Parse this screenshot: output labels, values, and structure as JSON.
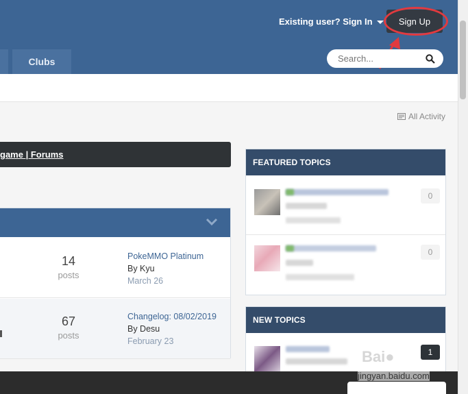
{
  "header": {
    "signin_label": "Existing user? Sign In",
    "signup_label": "Sign Up",
    "tabs": [
      {
        "label": "Clubs"
      }
    ],
    "search_placeholder": "Search..."
  },
  "activity": {
    "label": "All Activity"
  },
  "breadcrumb": {
    "text": "game | Forums"
  },
  "forum_rows": [
    {
      "posts": "14",
      "posts_label": "posts",
      "last_title": "PokeMMO Platinum",
      "last_by": "By Kyu",
      "last_date": "March 26"
    },
    {
      "posts": "67",
      "posts_label": "posts",
      "last_title": "Changelog: 08/02/2019",
      "last_by": "By Desu",
      "last_date": "February 23"
    }
  ],
  "featured": {
    "title": "FEATURED TOPICS",
    "items": [
      {
        "count": "0"
      },
      {
        "count": "0"
      }
    ]
  },
  "new_topics": {
    "title": "NEW TOPICS",
    "items": [
      {
        "count": "1"
      }
    ]
  },
  "watermark": {
    "text": "jingyan.baidu.com"
  },
  "colors": {
    "header": "#3d6594",
    "widget_head": "#344c6a",
    "highlight": "#e23a3f"
  }
}
